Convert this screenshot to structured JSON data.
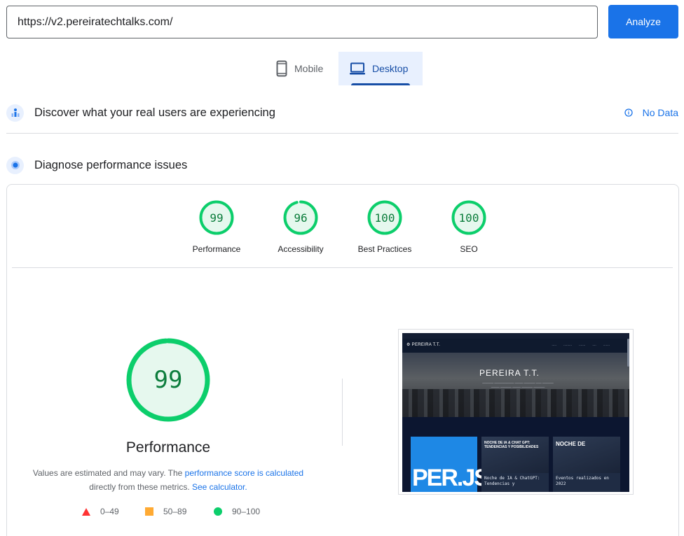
{
  "search": {
    "value": "https://v2.pereiratechtalks.com/",
    "analyze_label": "Analyze"
  },
  "tabs": [
    {
      "label": "Mobile",
      "icon": "phone-icon"
    },
    {
      "label": "Desktop",
      "icon": "laptop-icon",
      "selected": true
    }
  ],
  "field_data": {
    "title": "Discover what your real users are experiencing",
    "status": "No Data"
  },
  "lab": {
    "title": "Diagnose performance issues"
  },
  "scores": [
    {
      "label": "Performance",
      "value": "99"
    },
    {
      "label": "Accessibility",
      "value": "96"
    },
    {
      "label": "Best Practices",
      "value": "100"
    },
    {
      "label": "SEO",
      "value": "100"
    }
  ],
  "performance": {
    "score": "99",
    "title": "Performance",
    "desc_pre": "Values are estimated and may vary. The ",
    "desc_link1": "performance score is calculated",
    "desc_mid": " directly from these metrics. ",
    "desc_link2": "See calculator."
  },
  "legend": [
    {
      "range": "0–49",
      "color": "#ff3333"
    },
    {
      "range": "50–89",
      "color": "#ffaa33"
    },
    {
      "range": "90–100",
      "color": "#0cce6b"
    }
  ],
  "colors": {
    "accent": "#1a73e8",
    "pass": "#0cce6b",
    "pass_text": "#0c7d3c"
  }
}
